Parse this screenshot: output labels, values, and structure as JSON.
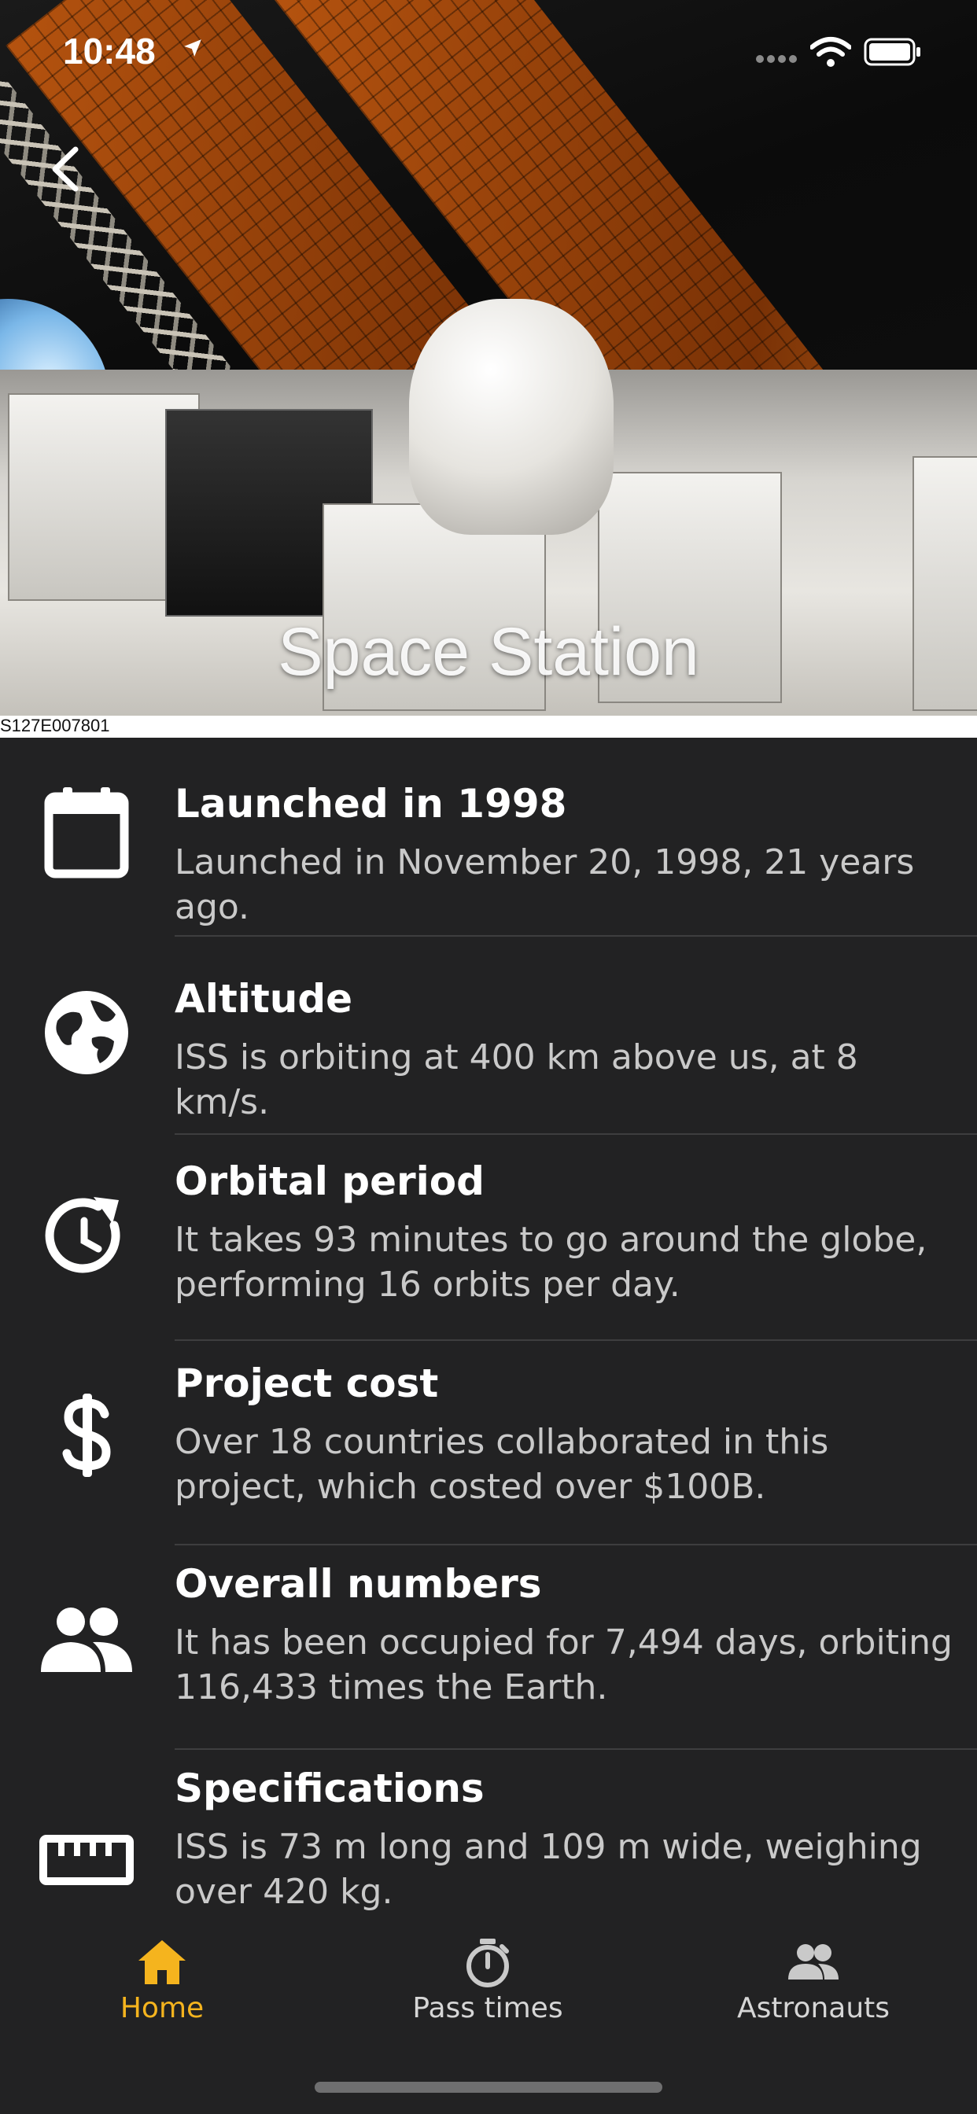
{
  "status_bar": {
    "time": "10:48"
  },
  "hero": {
    "title": "Space Station",
    "photo_caption": "S127E007801"
  },
  "facts": [
    {
      "icon": "calendar-icon",
      "title": "Launched in 1998",
      "description": "Launched in November 20, 1998, 21 years ago."
    },
    {
      "icon": "globe-icon",
      "title": "Altitude",
      "description": "ISS is orbiting at 400 km above us, at 8 km/s."
    },
    {
      "icon": "clock-refresh-icon",
      "title": "Orbital period",
      "description": "It takes 93 minutes to go around the globe, performing 16 orbits per day."
    },
    {
      "icon": "dollar-icon",
      "title": "Project cost",
      "description": "Over 18 countries collaborated in this project, which costed over $100B."
    },
    {
      "icon": "people-icon",
      "title": "Overall numbers",
      "description": "It has been occupied for 7,494 days, orbiting 116,433 times the Earth."
    },
    {
      "icon": "ruler-icon",
      "title": "Specifications",
      "description": "ISS is 73 m long and 109 m wide, weighing over 420 kg."
    }
  ],
  "tabbar": {
    "tabs": [
      {
        "label": "Home",
        "icon": "home-icon",
        "active": true
      },
      {
        "label": "Pass times",
        "icon": "stopwatch-icon",
        "active": false
      },
      {
        "label": "Astronauts",
        "icon": "group-icon",
        "active": false
      }
    ]
  },
  "colors": {
    "background": "#222223",
    "accent": "#F5B41E",
    "text": "#FFFFFF",
    "secondary_text": "#C9C9C9"
  }
}
